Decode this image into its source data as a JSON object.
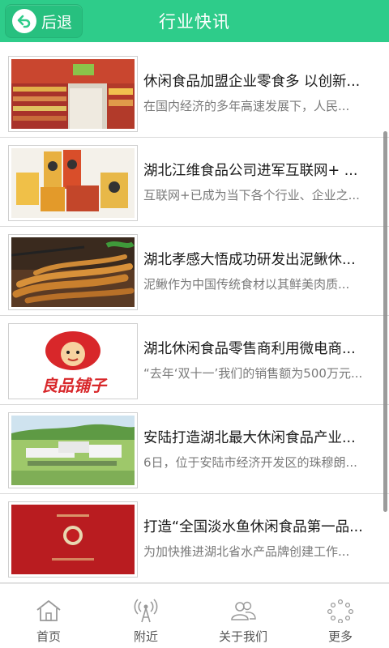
{
  "header": {
    "back_label": "后退",
    "title": "行业快讯"
  },
  "news": [
    {
      "title": "休闲食品加盟企业零食多 以创新...",
      "summary": "在国内经济的多年高速发展下，人民..."
    },
    {
      "title": "湖北江维食品公司进军互联网+ ...",
      "summary": "互联网+已成为当下各个行业、企业之..."
    },
    {
      "title": "湖北孝感大悟成功研发出泥鳅休...",
      "summary": "泥鳅作为中国传统食材以其鲜美肉质..."
    },
    {
      "title": "湖北休闲食品零售商利用微电商...",
      "summary": "“去年‘双十一’我们的销售额为500万元..."
    },
    {
      "title": "安陆打造湖北最大休闲食品产业...",
      "summary": "6日，位于安陆市经济开发区的珠穆朗..."
    },
    {
      "title": "打造“全国淡水鱼休闲食品第一品...",
      "summary": "为加快推进湖北省水产品牌创建工作..."
    }
  ],
  "thumb_logo_text": "良品铺子",
  "tabs": [
    {
      "label": "首页",
      "icon": "home-icon"
    },
    {
      "label": "附近",
      "icon": "signal-tower-icon"
    },
    {
      "label": "关于我们",
      "icon": "people-icon"
    },
    {
      "label": "更多",
      "icon": "more-dots-icon"
    }
  ],
  "colors": {
    "header_bg": "#2ecc8a",
    "title_text": "#1a1a1a",
    "summary_text": "#7a7a7a"
  }
}
